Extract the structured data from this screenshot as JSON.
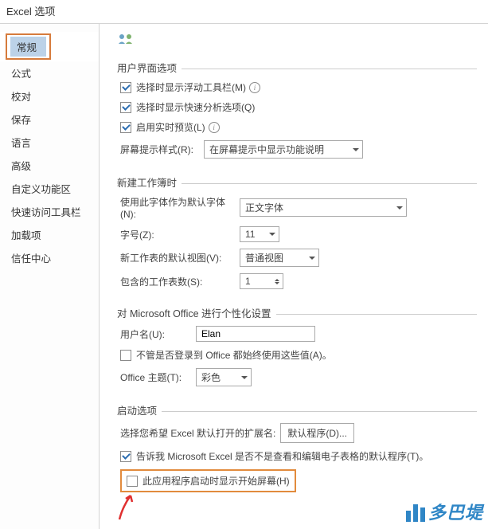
{
  "window": {
    "title": "Excel 选项"
  },
  "sidebar": {
    "items": [
      {
        "label": "常规",
        "selected": true
      },
      {
        "label": "公式"
      },
      {
        "label": "校对"
      },
      {
        "label": "保存"
      },
      {
        "label": "语言"
      },
      {
        "label": "高级"
      },
      {
        "label": "自定义功能区"
      },
      {
        "label": "快速访问工具栏"
      },
      {
        "label": "加载项"
      },
      {
        "label": "信任中心"
      }
    ]
  },
  "sections": {
    "ui": {
      "title": "用户界面选项",
      "miniFloat": "选择时显示浮动工具栏(M)",
      "quickAnalysis": "选择时显示快速分析选项(Q)",
      "livePreview": "启用实时预览(L)",
      "tipStyleLabel": "屏幕提示样式(R):",
      "tipStyleValue": "在屏幕提示中显示功能说明"
    },
    "newWb": {
      "title": "新建工作簿时",
      "fontLabel": "使用此字体作为默认字体(N):",
      "fontValue": "正文字体",
      "sizeLabel": "字号(Z):",
      "sizeValue": "11",
      "viewLabel": "新工作表的默认视图(V):",
      "viewValue": "普通视图",
      "sheetsLabel": "包含的工作表数(S):",
      "sheetsValue": "1"
    },
    "personalize": {
      "title": "对 Microsoft Office 进行个性化设置",
      "userLabel": "用户名(U):",
      "userValue": "Elan",
      "alwaysUse": "不管是否登录到 Office 都始终使用这些值(A)。",
      "themeLabel": "Office 主题(T):",
      "themeValue": "彩色"
    },
    "startup": {
      "title": "启动选项",
      "extLabel": "选择您希望 Excel 默认打开的扩展名:",
      "extBtn": "默认程序(D)...",
      "tellMe": "告诉我 Microsoft Excel 是否不是查看和编辑电子表格的默认程序(T)。",
      "showStart": "此应用程序启动时显示开始屏幕(H)"
    }
  },
  "watermark": "多巴堤"
}
